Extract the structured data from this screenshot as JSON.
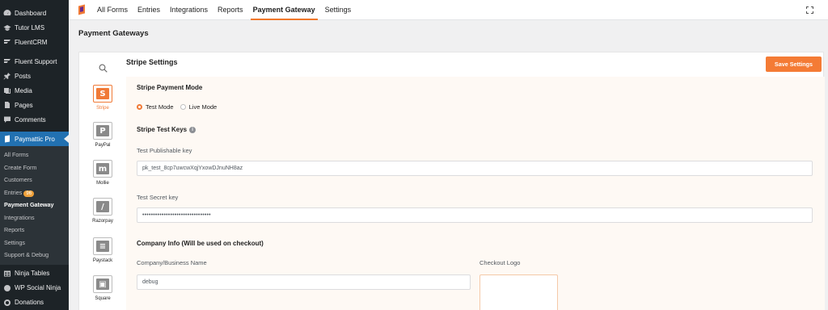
{
  "sidebar": {
    "top_items": [
      {
        "label": "Dashboard",
        "icon": "dashboard-icon"
      },
      {
        "label": "Tutor LMS",
        "icon": "mortarboard-icon"
      },
      {
        "label": "FluentCRM",
        "icon": "fluentcrm-icon"
      }
    ],
    "mid_items": [
      {
        "label": "Fluent Support",
        "icon": "fluent-support-icon"
      },
      {
        "label": "Posts",
        "icon": "pin-icon"
      },
      {
        "label": "Media",
        "icon": "media-icon"
      },
      {
        "label": "Pages",
        "icon": "pages-icon"
      },
      {
        "label": "Comments",
        "icon": "comment-icon"
      }
    ],
    "active_item": {
      "label": "Paymattic Pro",
      "icon": "paymattic-icon"
    },
    "submenu": [
      {
        "label": "All Forms"
      },
      {
        "label": "Create Form"
      },
      {
        "label": "Customers"
      },
      {
        "label": "Entries",
        "badge": "96"
      },
      {
        "label": "Payment Gateway",
        "current": true
      },
      {
        "label": "Integrations"
      },
      {
        "label": "Reports"
      },
      {
        "label": "Settings"
      },
      {
        "label": "Support & Debug"
      }
    ],
    "bottom_items": [
      {
        "label": "Ninja Tables",
        "icon": "table-icon"
      },
      {
        "label": "WP Social Ninja",
        "icon": "social-ninja-icon"
      },
      {
        "label": "Donations",
        "icon": "donations-icon"
      }
    ]
  },
  "topnav": {
    "links": [
      "All Forms",
      "Entries",
      "Integrations",
      "Reports",
      "Payment Gateway",
      "Settings"
    ],
    "active": "Payment Gateway"
  },
  "page": {
    "title": "Payment Gateways"
  },
  "gateways": [
    {
      "label": "Stripe",
      "glyph": "S",
      "active": true
    },
    {
      "label": "PayPal",
      "glyph": "P"
    },
    {
      "label": "Mollie",
      "glyph": "m"
    },
    {
      "label": "Razorpay",
      "glyph": "/"
    },
    {
      "label": "Paystack",
      "glyph": "≡"
    },
    {
      "label": "Square",
      "glyph": "▣"
    }
  ],
  "settings": {
    "title": "Stripe Settings",
    "save_label": "Save Settings",
    "payment_mode_heading": "Stripe Payment Mode",
    "mode_options": [
      "Test Mode",
      "Live Mode"
    ],
    "selected_mode": "Test Mode",
    "keys_heading": "Stripe Test Keys",
    "publishable_label": "Test Publishable key",
    "publishable_value": "pk_test_8cp7uwcwXqjYxowDJnuNH8az",
    "secret_label": "Test Secret key",
    "secret_value": "••••••••••••••••••••••••••••••••",
    "company_heading": "Company Info (Will be used on checkout)",
    "business_name_label": "Company/Business Name",
    "business_name_value": "debug",
    "checkout_logo_label": "Checkout Logo"
  },
  "colors": {
    "accent": "#f07a37",
    "sidebar_bg": "#1d2327",
    "sidebar_active": "#2271b1",
    "panel_bg": "#fef9f4"
  }
}
